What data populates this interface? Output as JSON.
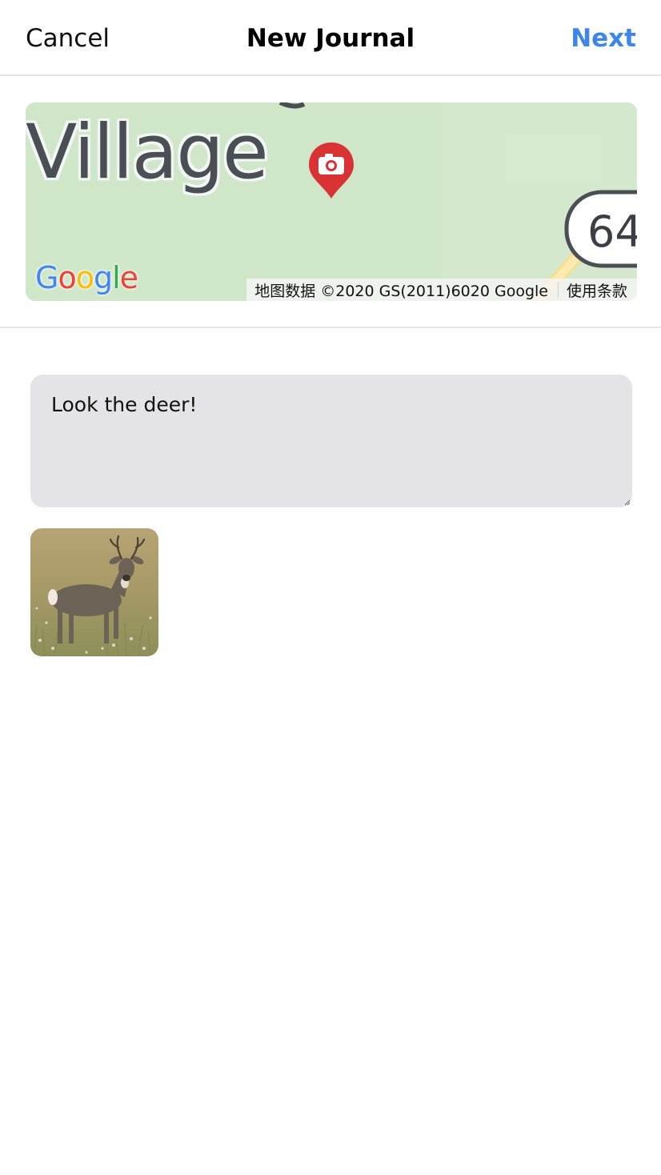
{
  "header": {
    "cancel_label": "Cancel",
    "title": "New Journal",
    "next_label": "Next"
  },
  "map": {
    "place_label": "Village",
    "road_number": "64",
    "google_logo_text": "Google",
    "attribution": "地图数据 ©2020 GS(2011)6020 Google",
    "terms_label": "使用条款",
    "pin_icon": "camera-pin-icon"
  },
  "journal": {
    "note_text": "Look the deer!"
  },
  "photos": [
    {
      "subject": "deer-photo"
    }
  ],
  "colors": {
    "accent": "#3d85e8",
    "pin": "#d93234",
    "map_green": "#cfe6c9",
    "input_bg": "#e4e4e8"
  }
}
